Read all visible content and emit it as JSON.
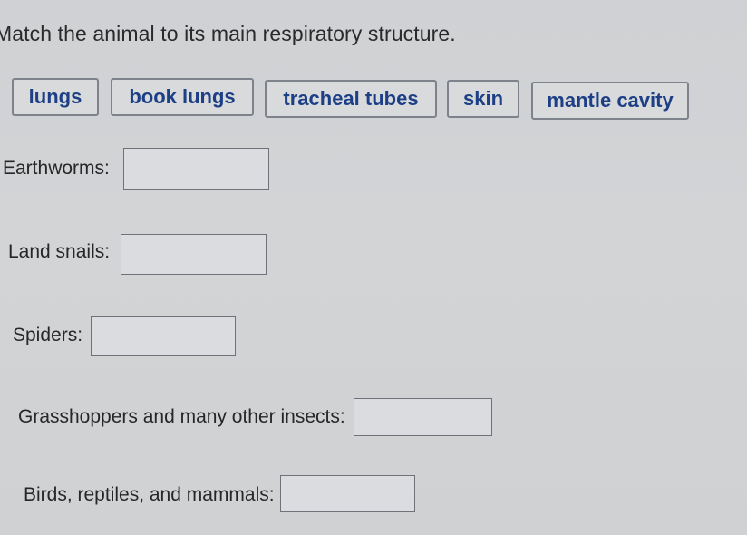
{
  "instruction": "Match the animal to its main respiratory structure.",
  "answer_bank": {
    "chips": [
      {
        "label": "lungs"
      },
      {
        "label": "book lungs"
      },
      {
        "label": "tracheal tubes"
      },
      {
        "label": "skin"
      },
      {
        "label": "mantle cavity"
      }
    ]
  },
  "questions": [
    {
      "label": "Earthworms:",
      "answer": ""
    },
    {
      "label": "Land snails:",
      "answer": ""
    },
    {
      "label": "Spiders:",
      "answer": ""
    },
    {
      "label": "Grasshoppers and many other insects:",
      "answer": ""
    },
    {
      "label": "Birds, reptiles, and mammals:",
      "answer": ""
    }
  ],
  "colors": {
    "chip_text": "#1d3f86",
    "background": "#d0d2d5"
  }
}
